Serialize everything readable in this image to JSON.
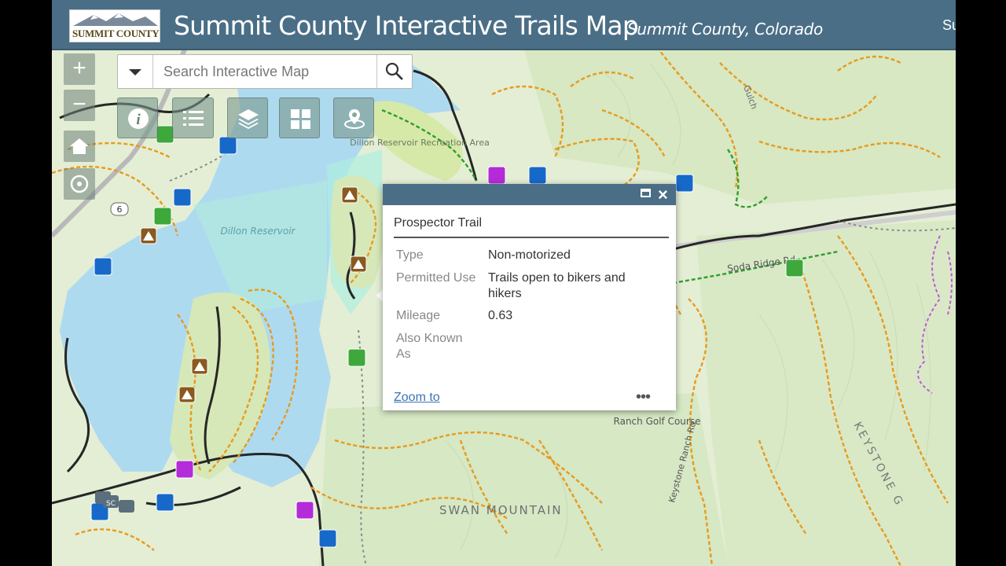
{
  "header": {
    "logo_text": "SUMMIT COUNTY",
    "title": "Summit County Interactive Trails Map",
    "subtitle": "Summit County, Colorado",
    "right_text": "Su"
  },
  "nav": {
    "zoom_in": "+",
    "zoom_out": "−"
  },
  "search": {
    "placeholder": "Search Interactive Map"
  },
  "toolbar": {
    "icons": [
      "info-icon",
      "legend-list-icon",
      "layers-icon",
      "basemap-gallery-icon",
      "locate-icon"
    ]
  },
  "popup": {
    "title": "Prospector Trail",
    "fields": [
      {
        "label": "Type",
        "value": "Non-motorized"
      },
      {
        "label": "Permitted Use",
        "value": "Trails open to bikers and hikers"
      },
      {
        "label": "Mileage",
        "value": "0.63"
      },
      {
        "label": "Also Known As",
        "value": ""
      }
    ],
    "zoom_link": "Zoom to",
    "more": "•••"
  },
  "map_labels": {
    "dillon_reservoir": "Dillon Reservoir",
    "swan_mountain": "SWAN MOUNTAIN",
    "soda_ridge_rd": "Soda Ridge Rd",
    "keystone_ranch_rd": "Keystone Ranch Rd",
    "keystone_gulch": "KEYSTONE G",
    "golf_course": "Ranch Golf Course",
    "recreation_area": "Dillon Reservoir Recreation Area",
    "highway_6": "6",
    "gulch": "Gulch",
    "sc": "SC"
  },
  "colors": {
    "header": "#4a6e86",
    "water": "#aad8ee",
    "land": "#e3efd2",
    "trail_orange": "#e89a1c",
    "trail_green": "#2e9e2e",
    "trail_purple": "#c05ad8",
    "road_black": "#222222",
    "parking_blue": "#1769c9",
    "campground_brown": "#8a5a1e"
  }
}
